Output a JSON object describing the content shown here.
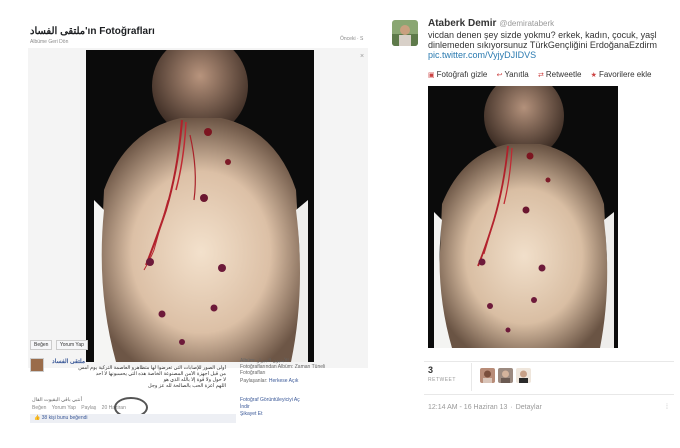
{
  "facebook": {
    "title": "ملتقى الفساد'ın Fotoğrafları",
    "subtitle": "Albüme Geri Dön",
    "options": "Önceki · S",
    "close_glyph": "×",
    "buttons": [
      "Beğen",
      "Yorum Yap"
    ],
    "author": "ملتقى الفساد",
    "post_lines": [
      "أولى الصور للإصابات التي تعرضوا لها متظاهرو العاصمة التركية يوم أمس",
      "من قبل أجهزة الأمن المصنوعة الخاصة هذه التي يحسبونها لا أحد",
      "لا حول ولا قوة إلا بالله الذي هو",
      "اللهم أعزة الحب بالصالحة لله عز وجل"
    ],
    "meta_rtl": "أنتبي باقي البقيوت القال",
    "meta_items": [
      "Beğen",
      "Yorum Yap",
      "Paylaş",
      "20 Haziran"
    ],
    "like_count_text": "38 kişi bunu beğendi",
    "album_lines": [
      "Albüm: الأمنيون الجيرار",
      "Fotoğraflarından Albüm: Zaman Tüneli",
      "Fotoğrafları"
    ],
    "tagged_label": "Paylaşanlar:",
    "tagged_value": "Herkese Açık",
    "side_links": [
      "Fotoğraf Görüntüleyiciyi Aç",
      "İndir",
      "Şikayet Et"
    ]
  },
  "twitter": {
    "name": "Ataberk Demir",
    "handle": "@demirataberk",
    "text_lines": [
      "vicdan denen şey sizde yokmu? erkek, kadın, çocuk, yaşl",
      "dinlemeden sıkıyorsunuz TürkGençliğini ErdoğanaEzdirm"
    ],
    "link": "pic.twitter.com/VyjyDJIDVS",
    "actions": [
      {
        "icon": "photo-icon",
        "label": "Fotoğrafı gizle"
      },
      {
        "icon": "reply-icon",
        "label": "Yanıtla"
      },
      {
        "icon": "retweet-icon",
        "label": "Retweetle"
      },
      {
        "icon": "star-icon",
        "label": "Favorilere ekle"
      }
    ],
    "retweet_count": "3",
    "retweet_label": "RETWEET",
    "timestamp": "12:14 AM - 16 Haziran 13",
    "details": "Detaylar"
  },
  "colors": {
    "link_blue": "#2a7ab0",
    "fb_blue": "#3b5998"
  }
}
